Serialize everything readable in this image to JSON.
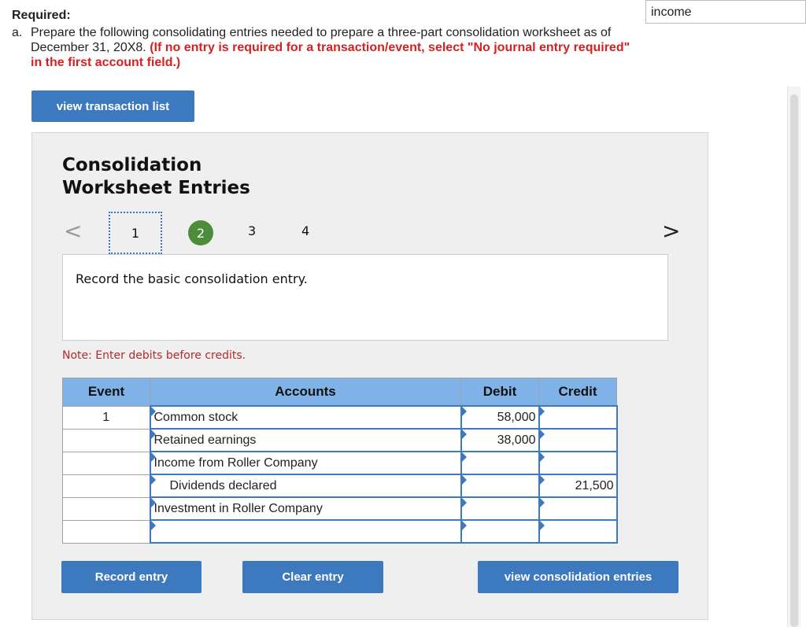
{
  "header": {
    "required_label": "Required:",
    "item_number": "a.",
    "instruction_line1": "Prepare the following consolidating entries needed to prepare a three-part consolidation worksheet as of",
    "instruction_line2": "December 31, 20X8.",
    "instruction_red": "(If no entry is required for a transaction/event, select \"No journal entry required\" in the first account field.)"
  },
  "top_field": {
    "value": "income"
  },
  "view_transaction_list_label": "view transaction list",
  "panel": {
    "title_line1": "Consolidation",
    "title_line2": "Worksheet Entries",
    "nav_prev": "<",
    "nav_next": ">",
    "steps": [
      "1",
      "2",
      "3",
      "4"
    ],
    "active_step": "2",
    "record_prompt": "Record the basic consolidation entry.",
    "note": "Note: Enter debits before credits."
  },
  "table": {
    "headers": {
      "event": "Event",
      "accounts": "Accounts",
      "debit": "Debit",
      "credit": "Credit"
    },
    "rows": [
      {
        "event": "1",
        "account": "Common stock",
        "debit": "58,000",
        "credit": ""
      },
      {
        "event": "",
        "account": "Retained earnings",
        "debit": "38,000",
        "credit": ""
      },
      {
        "event": "",
        "account": "Income from Roller Company",
        "debit": "",
        "credit": ""
      },
      {
        "event": "",
        "account": "Dividends declared",
        "debit": "",
        "credit": "21,500"
      },
      {
        "event": "",
        "account": "Investment in Roller Company",
        "debit": "",
        "credit": ""
      },
      {
        "event": "",
        "account": "",
        "debit": "",
        "credit": ""
      }
    ]
  },
  "buttons": {
    "record_entry": "Record entry",
    "clear_entry": "Clear entry",
    "view_consolidation_entries": "view consolidation entries"
  },
  "colors": {
    "button_blue": "#3d79bf",
    "header_blue": "#7fb2e6",
    "active_step_green": "#4b8d3a",
    "instruction_red": "#d32222"
  }
}
